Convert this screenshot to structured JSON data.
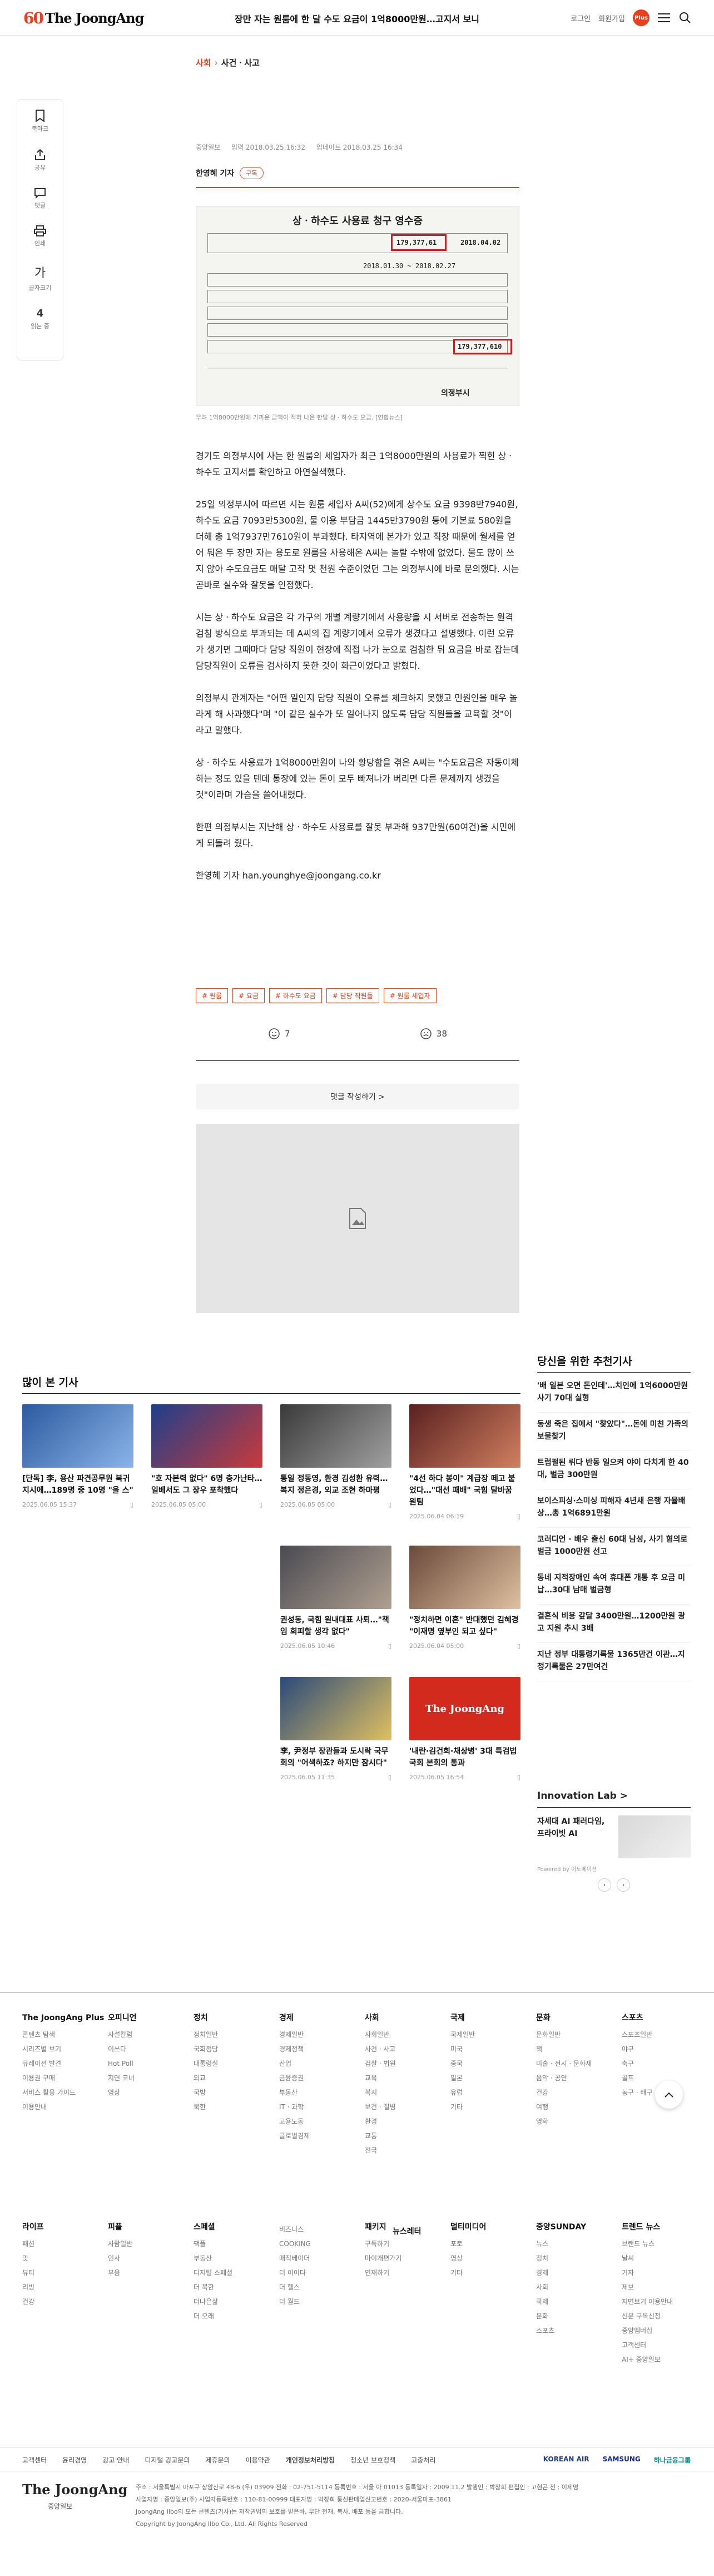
{
  "header": {
    "logo_prefix": "60",
    "logo_text": "The JoongAng",
    "headline": "장만 자는 원룸에 한 달 수도 요금이 1억8000만원…고지서 보니",
    "login": "로그인",
    "signup": "회원가입",
    "plus_badge": "Plus"
  },
  "breadcrumb": {
    "section": "사회",
    "subsection": "사건ㆍ사고"
  },
  "sidebar": {
    "bookmark": "북마크",
    "share": "공유",
    "comment": "댓글",
    "print": "인쇄",
    "font_glyph": "가",
    "font": "글자크기",
    "count": "4",
    "count_label": "읽는 중"
  },
  "article": {
    "meta_label": "중앙일보",
    "published": "입력 2018.03.25 16:32",
    "updated": "업데이트 2018.03.25 16:34",
    "reporter": "한영혜 기자",
    "subscribe": "구독",
    "receipt": {
      "title": "상ㆍ하수도 사용료 청구 영수증",
      "amount1": "179,377,61",
      "amount2": "179,377,610",
      "period": "2018.01.30 ~ 2018.02.27",
      "due": "2018.04.02",
      "stamp": "의정부시"
    },
    "caption": "무려 1억8000만원에 가까운 금액이 적혀 나온 한달 상ㆍ하수도 요금. [연합뉴스]",
    "paragraphs": [
      "경기도 의정부시에 사는 한 원룸의 세입자가 최근 1억8000만원의 사용료가 찍힌 상ㆍ하수도 고지서를 확인하고 아연실색했다.",
      "25일 의정부시에 따르면 시는 원룸 세입자 A씨(52)에게 상수도 요금 9398만7940원, 하수도 요금 7093만5300원, 물 이용 부담금 1445만3790원 등에 기본료 580원을 더해 총 1억7937만7610원이 부과했다. 타지역에 본가가 있고 직장 때문에 월세를 얻어 둬은 두 장만 자는 용도로 원룸을 사용해온 A씨는 놀랄 수밖에 없었다. 물도 많이 쓰지 않아 수도요금도 매달 고작 몇 천원 수준이었던 그는 의정부시에 바로 문의했다. 시는 곧바로 실수와 잘못을 인정했다.",
      "시는 상ㆍ하수도 요금은 각 가구의 개별 계량기에서 사용량을 시 서버로 전송하는 원격 검침 방식으로 부과되는 데 A씨의 집 계량기에서 오류가 생겼다고 설명했다. 이런 오류가 생기면 그때마다 담당 직원이 현장에 직접 나가 눈으로 검침한 뒤 요금을 바로 잡는데 담당직원이 오류를 검사하지 못한 것이 화근이었다고 밝혔다.",
      "의정부시 관계자는 \"어떤 일인지 담당 직원이 오류를 체크하지 못했고 민원인을 매우 놀라게 해 사과했다\"며 \"이 같은 실수가 또 일어나지 않도록 담당 직원들을 교육할 것\"이라고 말했다.",
      "상ㆍ하수도 사용료가 1억8000만원이 나와 황당함을 겪은 A씨는 \"수도요금은 자동이체하는 정도 있을 텐데 통장에 있는 돈이 모두 빠져나가 버리면 다른 문제까지 생겼을 것\"이라며 가슴을 쓸어내렸다.",
      "한편 의정부시는 지난해 상ㆍ하수도 사용료를 잘못 부과해 937만원(60여건)을 시민에게 되돌려 줬다.",
      "한영혜 기자 han.younghye@joongang.co.kr"
    ],
    "tags": [
      "# 원룸",
      "# 요금",
      "# 하수도 요금",
      "# 담당 직원들",
      "# 원룸 세입자"
    ],
    "likes": "7",
    "dislikes": "38",
    "comment_button": "댓글 작성하기 >"
  },
  "most_viewed": {
    "title": "많이 본 기사",
    "items": [
      {
        "title": "[단독] 李, 용산 파견공무원 복귀 지시에…189명 중 10명 \"올 스\"",
        "date": "2025.06.05 15:37"
      },
      {
        "title": "\"호 자본력 없다\" 6명 충가난타…일베서도 그 장우 포착했다",
        "date": "2025.06.05 05:00"
      },
      {
        "title": "통일 정동영, 환경 김성환 유력…복지 정은경, 외교 조현 하마평",
        "date": "2025.06.05 05:00"
      },
      {
        "title": "\"4선 하다 봉이\" 계급장 떼고 붙었다…\"대선 패배\" 국힘 탈바꿈 원팀",
        "date": "2025.06.04 06:19"
      },
      {
        "title": "권성동, 국힘 원내대표 사퇴…\"책임 회피할 생각 없다\"",
        "date": "2025.06.05 10:46"
      },
      {
        "title": "\"정치하면 이혼\" 반대했던 김혜경 \"이재명 옆부인 되고 싶다\"",
        "date": "2025.06.04 05:00"
      },
      {
        "title": "李, 尹정부 장관들과 도시락 국무회의 \"어색하죠? 하지만 잠시다\"",
        "date": "2025.06.05 11:35"
      },
      {
        "title": "'내란·김건희·채상병' 3대 특검법 국회 본회의 통과",
        "date": "2025.06.05 16:54"
      }
    ]
  },
  "recommended": {
    "title": "당신을 위한 추천기사",
    "items": [
      "'배 일본 오면 돈인데'…치인에 1억6000만원 사기 70대 실형",
      "동생 죽은 집에서 \"찾았다\"…돈에 미친 가족의 보물찾기",
      "트럼펄된 뤼다 반동 일으켜 야이 다치게 한 40대, 벌금 300만원",
      "보이스피싱·스미싱 피해자 4년새 은행 자율배상…총 1억6891만원",
      "코러디언 · 배우 출신 60대 남성, 사기 혐의로 벌금 1000만원 선고",
      "동네 지적장애인 속여 휴대폰 개통 후 요금 미납…30대 남매 벌금형",
      "결혼식 비용 갚달 3400만원…1200만원 광고 지원 추시 3배",
      "지난 정부 대통령기록물 1365만건 이관…지정기록물은 27만여건"
    ]
  },
  "innovation": {
    "title": "Innovation Lab >",
    "text": "자세대 AI 패러다임, 프라이빗 AI",
    "by": "Powered by 이노베이션"
  },
  "footer": {
    "brand": "The JoongAng Plus",
    "columns": [
      {
        "head": "The JoongAng Plus",
        "items": [
          "콘텐츠 탐색",
          "시리즈별 보기",
          "큐레이션 발견",
          "이용권 구매",
          "서비스 활용 가이드",
          "이용안내"
        ]
      },
      {
        "head": "오피니언",
        "items": [
          "사설칼럼",
          "이쓰다",
          "Hot Poll",
          "지면 코너",
          "영상"
        ]
      },
      {
        "head": "정치",
        "items": [
          "정치일반",
          "국회정당",
          "대통령실",
          "외교",
          "국방",
          "북한"
        ]
      },
      {
        "head": "경제",
        "items": [
          "경제일반",
          "경제정책",
          "산업",
          "금융증권",
          "부동산",
          "IT · 과학",
          "고용노동",
          "글로벌경제"
        ]
      },
      {
        "head": "사회",
        "items": [
          "사회일반",
          "사건ㆍ사고",
          "검찰 · 법원",
          "교육",
          "복지",
          "보건 · 질병",
          "환경",
          "교통",
          "전국"
        ]
      },
      {
        "head": "국제",
        "items": [
          "국제일반",
          "미국",
          "중국",
          "일본",
          "유럽",
          "기타"
        ]
      },
      {
        "head": "문화",
        "items": [
          "문화일반",
          "책",
          "미술 · 전시 · 문화재",
          "음악 · 공연",
          "건강",
          "여행",
          "영화"
        ]
      },
      {
        "head": "스포츠",
        "items": [
          "스포츠일반",
          "야구",
          "축구",
          "골프",
          "농구 · 배구"
        ]
      },
      {
        "head": "라이프",
        "items": [
          "패션",
          "맛",
          "뷰티",
          "리빙",
          "건강"
        ]
      },
      {
        "head": "피플",
        "items": [
          "사람일반",
          "인사",
          "부음"
        ]
      },
      {
        "head": "스페셜",
        "items": [
          "팩플",
          "부동산",
          "디지털 스페셜",
          "더 북한",
          "더나은삶",
          "더 오래"
        ]
      },
      {
        "head": "",
        "items": [
          "비즈니스",
          "COOKING",
          "매직베이더",
          "더 이이다",
          "더 헬스",
          "더 월드"
        ]
      },
      {
        "head": "패키지",
        "items": [
          "구독하기",
          "마이개편가기",
          "연재하기"
        ]
      },
      {
        "head": "멀티미디어",
        "items": [
          "포토",
          "영상",
          "기타"
        ]
      },
      {
        "head": "중앙SUNDAY",
        "items": [
          "뉴스",
          "정치",
          "경제",
          "사회",
          "국제",
          "문화",
          "스포츠"
        ]
      },
      {
        "head": "트렌드 뉴스",
        "items": [
          "브랜드 뉴스",
          "날씨",
          "기자",
          "제보",
          "지면보기 이용안내",
          "신문 구독신청",
          "중앙멤버십",
          "고객센터",
          "AI+ 중앙일보"
        ]
      }
    ],
    "newsletter": "뉴스레터",
    "links": [
      "고객센터",
      "윤리경영",
      "광고 안내",
      "디지털 광고문의",
      "제휴문의",
      "이용약관",
      "개인정보처리방침",
      "청소년 보호정책",
      "고충처리"
    ],
    "brands": [
      "KOREAN AIR",
      "SAMSUNG",
      "하나금융그룹"
    ],
    "logo": "The JoongAng",
    "logo_sub": "중앙일보",
    "info1": "주소 : 서울특별시 마포구 상암산로 48-6 (우) 03909   전화 : 02-751-5114   등록번호 : 서울 아 01013   등록일자 : 2009.11.2   발행인 : 박장희   편집인 : 고현곤   전 : 이제명",
    "info2": "사업자명 : 중앙일보(주)   사업자등록번호 : 110-81-00999   대표자명 : 박장희   통신판매업신고번호 : 2020-서울마포-3861",
    "info3": "JoongAng Ilbo의 모든 콘텐츠(기사)는 저작권법의 보호를 받은바, 무단 전재, 복사, 배포 등을 금합니다.",
    "copyright": "Copyright by JoongAng Ilbo Co., Ltd. All Rights Reserved"
  },
  "colors": {
    "accent": "#e8401c",
    "receipt_highlight": "#e0131d"
  }
}
